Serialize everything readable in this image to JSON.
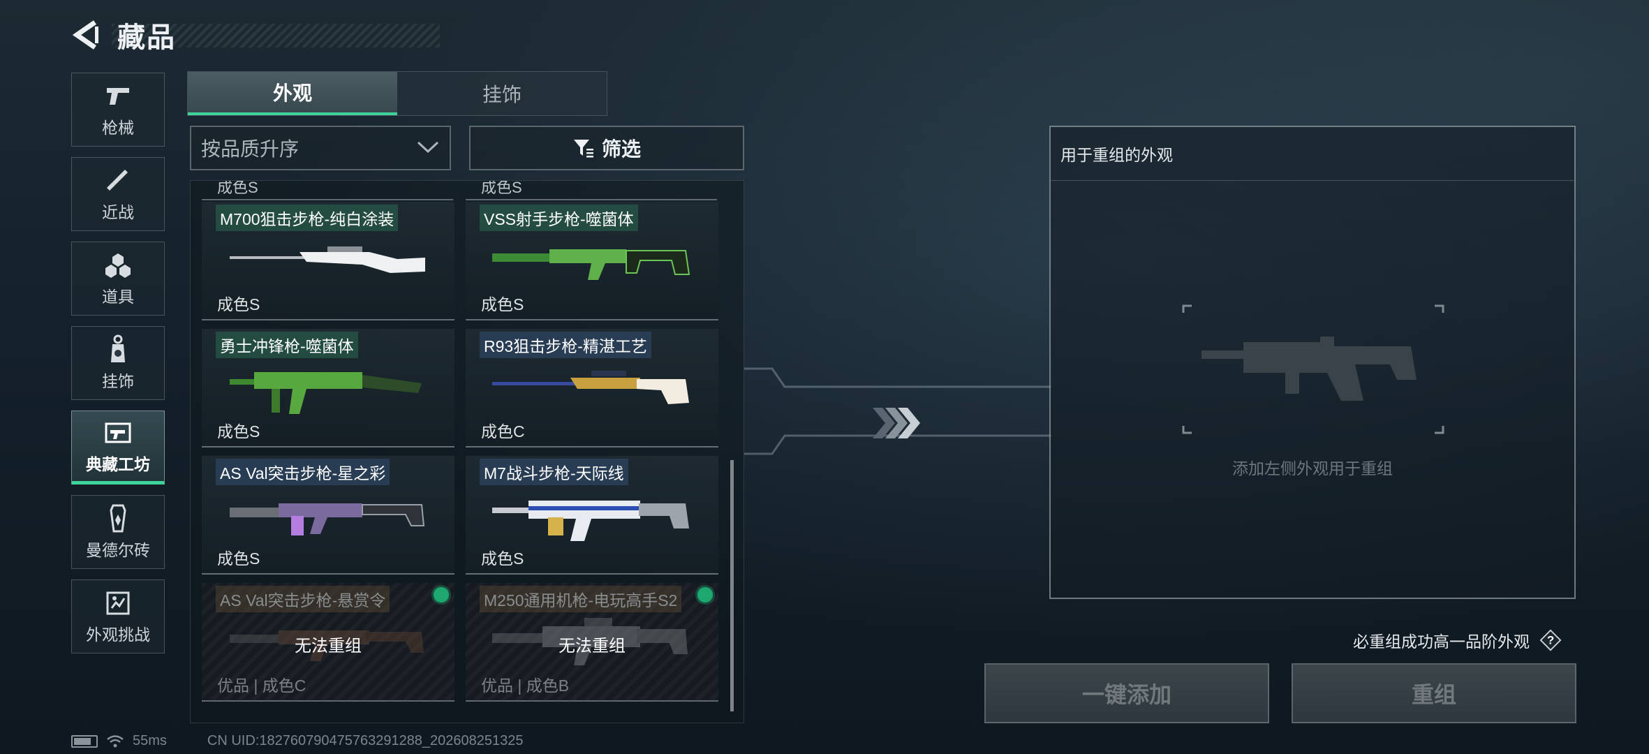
{
  "header": {
    "title": "藏品"
  },
  "nav": [
    {
      "label": "枪械",
      "icon": "pistol-icon",
      "active": false
    },
    {
      "label": "近战",
      "icon": "knife-icon",
      "active": false
    },
    {
      "label": "道具",
      "icon": "grenade-icon",
      "active": false
    },
    {
      "label": "挂饰",
      "icon": "charm-icon",
      "active": false
    },
    {
      "label": "典藏工坊",
      "icon": "workshop-icon",
      "active": true
    },
    {
      "label": "曼德尔砖",
      "icon": "mandel-brick-icon",
      "active": false
    },
    {
      "label": "外观挑战",
      "icon": "challenge-icon",
      "active": false
    }
  ],
  "tabs": [
    {
      "label": "外观",
      "active": true
    },
    {
      "label": "挂饰",
      "active": false
    }
  ],
  "sort": {
    "label": "按品质升序"
  },
  "filter": {
    "label": "筛选"
  },
  "grid": {
    "cut_label": "成色S",
    "cards": [
      {
        "name": "M700狙击步枪-纯白涂装",
        "grade": "成色S",
        "disabled": false
      },
      {
        "name": "VSS射手步枪-噬菌体",
        "grade": "成色S",
        "disabled": false
      },
      {
        "name": "勇士冲锋枪-噬菌体",
        "grade": "成色S",
        "disabled": false
      },
      {
        "name": "R93狙击步枪-精湛工艺",
        "grade": "成色C",
        "disabled": false
      },
      {
        "name": "AS Val突击步枪-星之彩",
        "grade": "成色S",
        "disabled": false
      },
      {
        "name": "M7战斗步枪-天际线",
        "grade": "成色S",
        "disabled": false
      },
      {
        "name": "AS Val突击步枪-悬赏令",
        "grade": "优品 | 成色C",
        "disabled": true,
        "overlay": "无法重组"
      },
      {
        "name": "M250通用机枪-电玩高手S2",
        "grade": "优品 | 成色B",
        "disabled": true,
        "overlay": "无法重组"
      }
    ]
  },
  "panel": {
    "title": "用于重组的外观",
    "hint": "添加左侧外观用于重组"
  },
  "note": "必重组成功高一品阶外观",
  "buttons": {
    "add_all": "一键添加",
    "recombine": "重组"
  },
  "status": {
    "ping": "55ms",
    "uid": "CN UID:182760790475763291288_202608251325"
  },
  "colors": {
    "accent": "#3fd29a",
    "badge": "#1ea870"
  }
}
